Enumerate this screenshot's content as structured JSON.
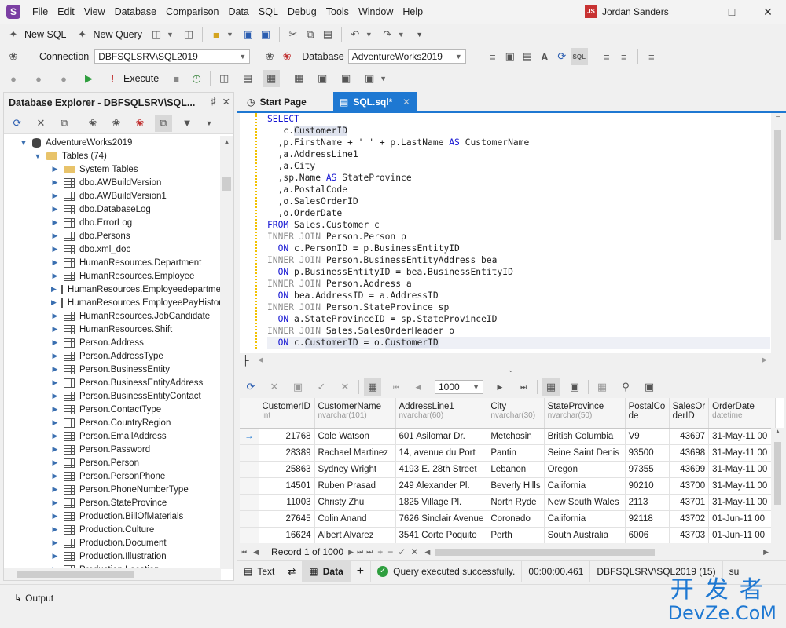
{
  "menu": [
    "File",
    "Edit",
    "View",
    "Database",
    "Comparison",
    "Data",
    "SQL",
    "Debug",
    "Tools",
    "Window",
    "Help"
  ],
  "user": {
    "initials": "JS",
    "name": "Jordan Sanders"
  },
  "toolbar1": {
    "new_sql": "New SQL",
    "new_query": "New Query"
  },
  "toolbar2": {
    "connection_label": "Connection",
    "connection_value": "DBFSQLSRV\\SQL2019",
    "database_label": "Database",
    "database_value": "AdventureWorks2019",
    "sql_badge": "SQL"
  },
  "toolbar3": {
    "execute": "Execute"
  },
  "explorer": {
    "title": "Database Explorer - DBFSQLSRV\\SQL...",
    "database": "AdventureWorks2019",
    "tables_folder": "Tables (74)",
    "items": [
      "System Tables",
      "dbo.AWBuildVersion",
      "dbo.AWBuildVersion1",
      "dbo.DatabaseLog",
      "dbo.ErrorLog",
      "dbo.Persons",
      "dbo.xml_doc",
      "HumanResources.Department",
      "HumanResources.Employee",
      "HumanResources.Employeedepartme",
      "HumanResources.EmployeePayHistor",
      "HumanResources.JobCandidate",
      "HumanResources.Shift",
      "Person.Address",
      "Person.AddressType",
      "Person.BusinessEntity",
      "Person.BusinessEntityAddress",
      "Person.BusinessEntityContact",
      "Person.ContactType",
      "Person.CountryRegion",
      "Person.EmailAddress",
      "Person.Password",
      "Person.Person",
      "Person.PersonPhone",
      "Person.PhoneNumberType",
      "Person.StateProvince",
      "Production.BillOfMaterials",
      "Production.Culture",
      "Production.Document",
      "Production.Illustration",
      "Production.Location"
    ]
  },
  "tabs": {
    "start_page": "Start Page",
    "sql_tab": "SQL.sql*"
  },
  "code": [
    {
      "cls": "kw",
      "t": "SELECT"
    },
    {
      "pre": "   c.",
      "hl": "CustomerID"
    },
    {
      "t": "  ,p.FirstName + ' ' + p.LastName ",
      "k2": "AS",
      "t2": " CustomerName"
    },
    {
      "t": "  ,a.AddressLine1"
    },
    {
      "t": "  ,a.City"
    },
    {
      "t": "  ,sp.Name ",
      "k2": "AS",
      "t2": " StateProvince"
    },
    {
      "t": "  ,a.PostalCode"
    },
    {
      "t": "  ,o.SalesOrderID"
    },
    {
      "t": "  ,o.OrderDate"
    },
    {
      "k1": "FROM",
      "t": " Sales.Customer c"
    },
    {
      "g": "INNER JOIN",
      "t": " Person.Person p"
    },
    {
      "k1": "  ON",
      "t": " c.PersonID = p.BusinessEntityID"
    },
    {
      "g": "INNER JOIN",
      "t": " Person.BusinessEntityAddress bea"
    },
    {
      "k1": "  ON",
      "t": " p.BusinessEntityID = bea.BusinessEntityID"
    },
    {
      "g": "INNER JOIN",
      "t": " Person.Address a"
    },
    {
      "k1": "  ON",
      "t": " bea.AddressID = a.AddressID"
    },
    {
      "g": "INNER JOIN",
      "t": " Person.StateProvince sp"
    },
    {
      "k1": "  ON",
      "t": " a.StateProvinceID = sp.StateProvinceID"
    },
    {
      "g": "INNER JOIN",
      "t": " Sales.SalesOrderHeader o"
    },
    {
      "k1": "  ON",
      "t": " c.",
      "hl": "CustomerID",
      "t2": " = o.",
      "hl2": "CustomerID",
      "cur": true
    }
  ],
  "grid_toolbar": {
    "page_size": "1000"
  },
  "grid": {
    "columns": [
      {
        "name": "CustomerID",
        "type": "int"
      },
      {
        "name": "CustomerName",
        "type": "nvarchar(101)"
      },
      {
        "name": "AddressLine1",
        "type": "nvarchar(60)"
      },
      {
        "name": "City",
        "type": "nvarchar(30)"
      },
      {
        "name": "StateProvince",
        "type": "nvarchar(50)"
      },
      {
        "name": "PostalCo de",
        "type": ""
      },
      {
        "name": "SalesOr derID",
        "type": ""
      },
      {
        "name": "OrderDate",
        "type": "datetime"
      }
    ],
    "rows": [
      [
        "21768",
        "Cole Watson",
        "601 Asilomar Dr.",
        "Metchosin",
        "British Columbia",
        "V9",
        "43697",
        "31-May-11 00"
      ],
      [
        "28389",
        "Rachael Martinez",
        "14, avenue du Port",
        "Pantin",
        "Seine Saint Denis",
        "93500",
        "43698",
        "31-May-11 00"
      ],
      [
        "25863",
        "Sydney Wright",
        "4193 E. 28th Street",
        "Lebanon",
        "Oregon",
        "97355",
        "43699",
        "31-May-11 00"
      ],
      [
        "14501",
        "Ruben Prasad",
        "249 Alexander Pl.",
        "Beverly Hills",
        "California",
        "90210",
        "43700",
        "31-May-11 00"
      ],
      [
        "11003",
        "Christy Zhu",
        "1825 Village Pl.",
        "North Ryde",
        "New South Wales",
        "2113",
        "43701",
        "31-May-11 00"
      ],
      [
        "27645",
        "Colin Anand",
        "7626 Sinclair Avenue",
        "Coronado",
        "California",
        "92118",
        "43702",
        "01-Jun-11 00"
      ],
      [
        "16624",
        "Albert Alvarez",
        "3541 Corte Poquito",
        "Perth",
        "South Australia",
        "6006",
        "43703",
        "01-Jun-11 00"
      ]
    ]
  },
  "navbar": {
    "record": "Record 1 of 1000"
  },
  "status": {
    "text_tab": "Text",
    "data_tab": "Data",
    "message": "Query executed successfully.",
    "elapsed": "00:00:00.461",
    "server": "DBFSQLSRV\\SQL2019 (15)",
    "user_short": "su"
  },
  "bottom": {
    "output": "Output"
  },
  "watermark": {
    "cn": "开发者",
    "en": "DevZe.CoM"
  },
  "colors": {
    "accent": "#1e78d2",
    "logo": "#7b3fa3",
    "keyword": "#1414d2",
    "success": "#2e9e3e"
  }
}
